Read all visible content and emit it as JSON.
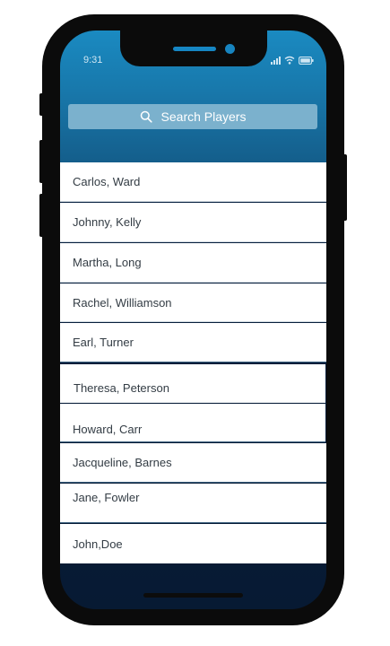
{
  "status_bar": {
    "time": "9:31"
  },
  "search": {
    "placeholder": "Search Players"
  },
  "players": [
    "Carlos, Ward",
    "Johnny, Kelly",
    "Martha, Long",
    "Rachel, Williamson",
    "Earl, Turner",
    "Theresa, Peterson",
    "Howard, Carr",
    "Jacqueline, Barnes",
    "Jane, Fowler",
    "John,Doe"
  ],
  "colors": {
    "header_top": "#1a8ac1",
    "header_bottom": "#145d8a",
    "search_bg": "#7bb1cd",
    "screen_bottom": "#092445",
    "divider": "#cfd8df",
    "divider_dark": "#3b5f7d"
  }
}
